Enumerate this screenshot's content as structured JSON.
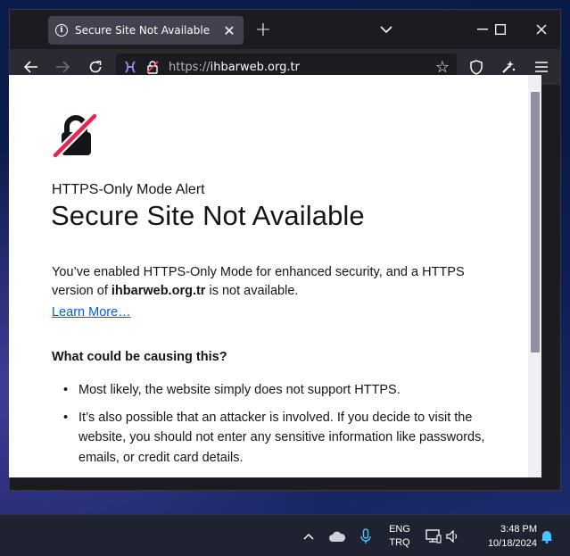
{
  "browser": {
    "tab": {
      "title": "Secure Site Not Available",
      "icon": "info-icon",
      "close_icon": "close-icon"
    },
    "window_controls": {
      "new_tab": "+",
      "list_tabs_icon": "chevron-down-icon",
      "minimize_icon": "minimize-icon",
      "maximize_icon": "maximize-icon",
      "close_icon": "close-icon"
    },
    "navbar": {
      "back_icon": "back-arrow-icon",
      "forward_icon": "forward-arrow-icon",
      "reload_icon": "reload-icon",
      "url_protocol": "https://",
      "url_host": "ihbarweb.org.tr",
      "bookmark_icon": "star-icon",
      "shield_icon": "shield-icon",
      "extensions_icon": "extensions-icon",
      "menu_icon": "hamburger-menu-icon"
    }
  },
  "page": {
    "alert_label": "HTTPS-Only Mode Alert",
    "title": "Secure Site Not Available",
    "description_prefix": "You’ve enabled HTTPS-Only Mode for enhanced security, and a HTTPS version of ",
    "description_host": "ihbarweb.org.tr",
    "description_suffix": " is not available.",
    "learn_more": "Learn More…",
    "causes_heading": "What could be causing this?",
    "causes": [
      "Most likely, the website simply does not support HTTPS.",
      "It’s also possible that an attacker is involved. If you decide to visit the website, you should not enter any sensitive information like passwords, emails, or credit card details."
    ],
    "accent_color": "#0061e0",
    "warning_color": "#e22850"
  },
  "taskbar": {
    "lang_line1": "ENG",
    "lang_line2": "TRQ",
    "time": "3:48 PM",
    "date": "10/18/2024"
  }
}
